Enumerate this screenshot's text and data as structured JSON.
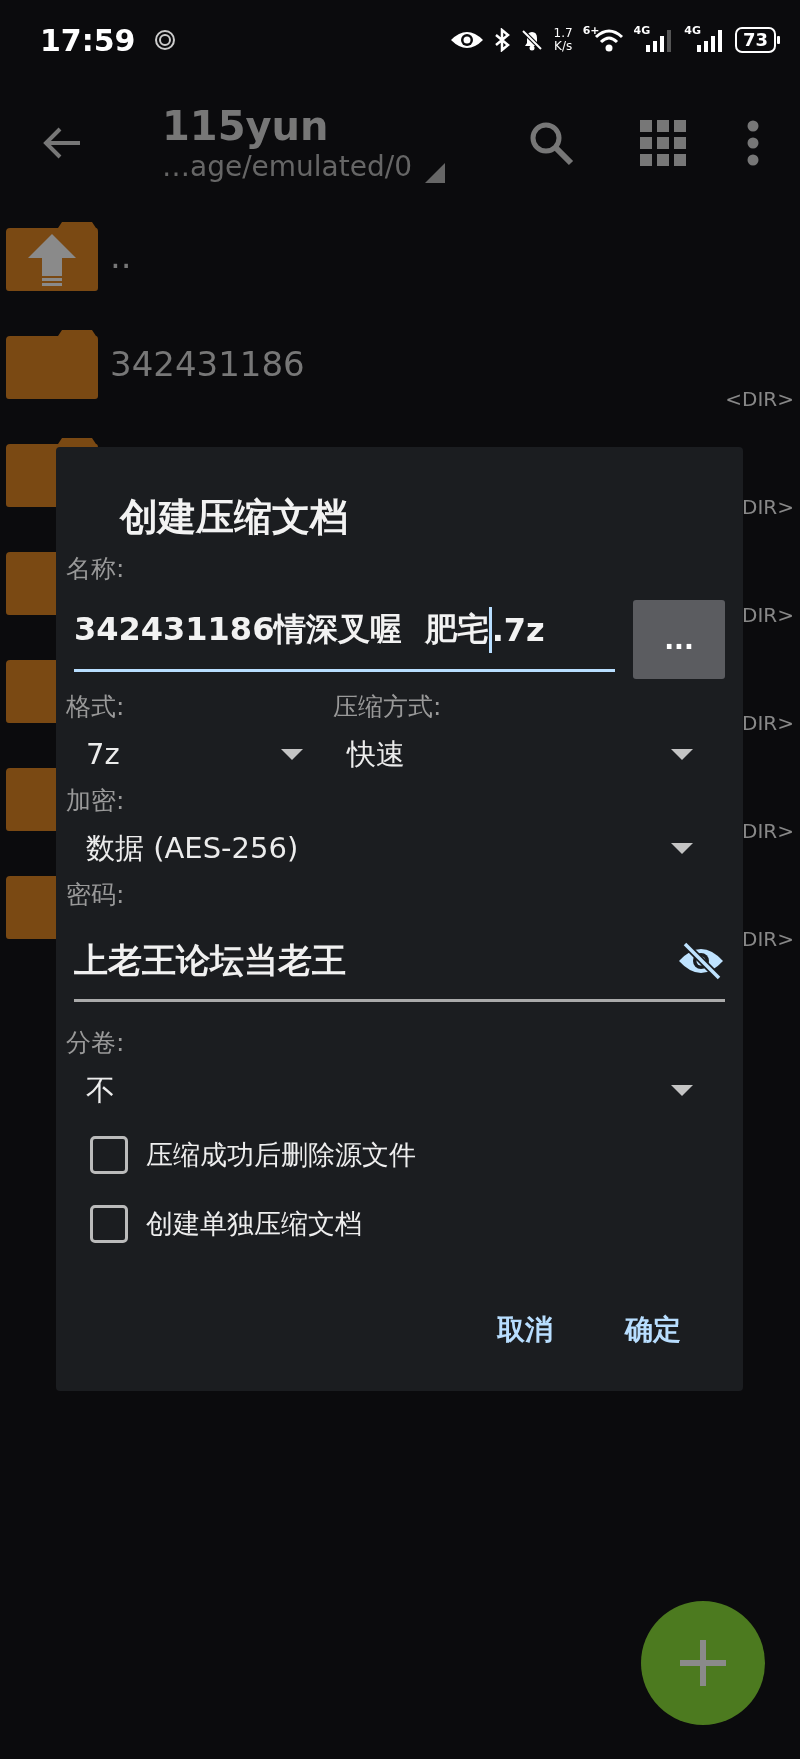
{
  "status_bar": {
    "time": "17:59",
    "speed_value": "1.7",
    "speed_unit": "K/s",
    "wifi_badge": "6+",
    "sim_1": "4G",
    "sim_2": "4G",
    "battery": "73"
  },
  "toolbar": {
    "title": "115yun",
    "path": "…age/emulated/0"
  },
  "files": [
    {
      "kind": "up",
      "name": ".."
    },
    {
      "kind": "folder",
      "name": "342431186",
      "tag": "<DIR>"
    },
    {
      "kind": "folder",
      "tag": "DIR>"
    },
    {
      "kind": "folder",
      "tag": "DIR>"
    },
    {
      "kind": "folder",
      "tag": "DIR>"
    },
    {
      "kind": "folder",
      "tag": "DIR>"
    },
    {
      "kind": "folder",
      "tag": "DIR>"
    }
  ],
  "dialog": {
    "title": "创建压缩文档",
    "name_label": "名称:",
    "name_before_cursor": "342431186情深叉喔  肥宅",
    "name_after_cursor": ".7z",
    "browse_button": "...",
    "format_label": "格式:",
    "format_value": "7z",
    "method_label": "压缩方式:",
    "method_value": "快速",
    "encryption_label": "加密:",
    "encryption_value": "数据 (AES-256)",
    "password_label": "密码:",
    "password_value": "上老王论坛当老王",
    "password_visible": true,
    "split_label": "分卷:",
    "split_value": "不",
    "options": [
      {
        "label": "压缩成功后删除源文件",
        "checked": false
      },
      {
        "label": "创建单独压缩文档",
        "checked": false
      }
    ],
    "buttons": [
      "取消",
      "确定"
    ]
  }
}
